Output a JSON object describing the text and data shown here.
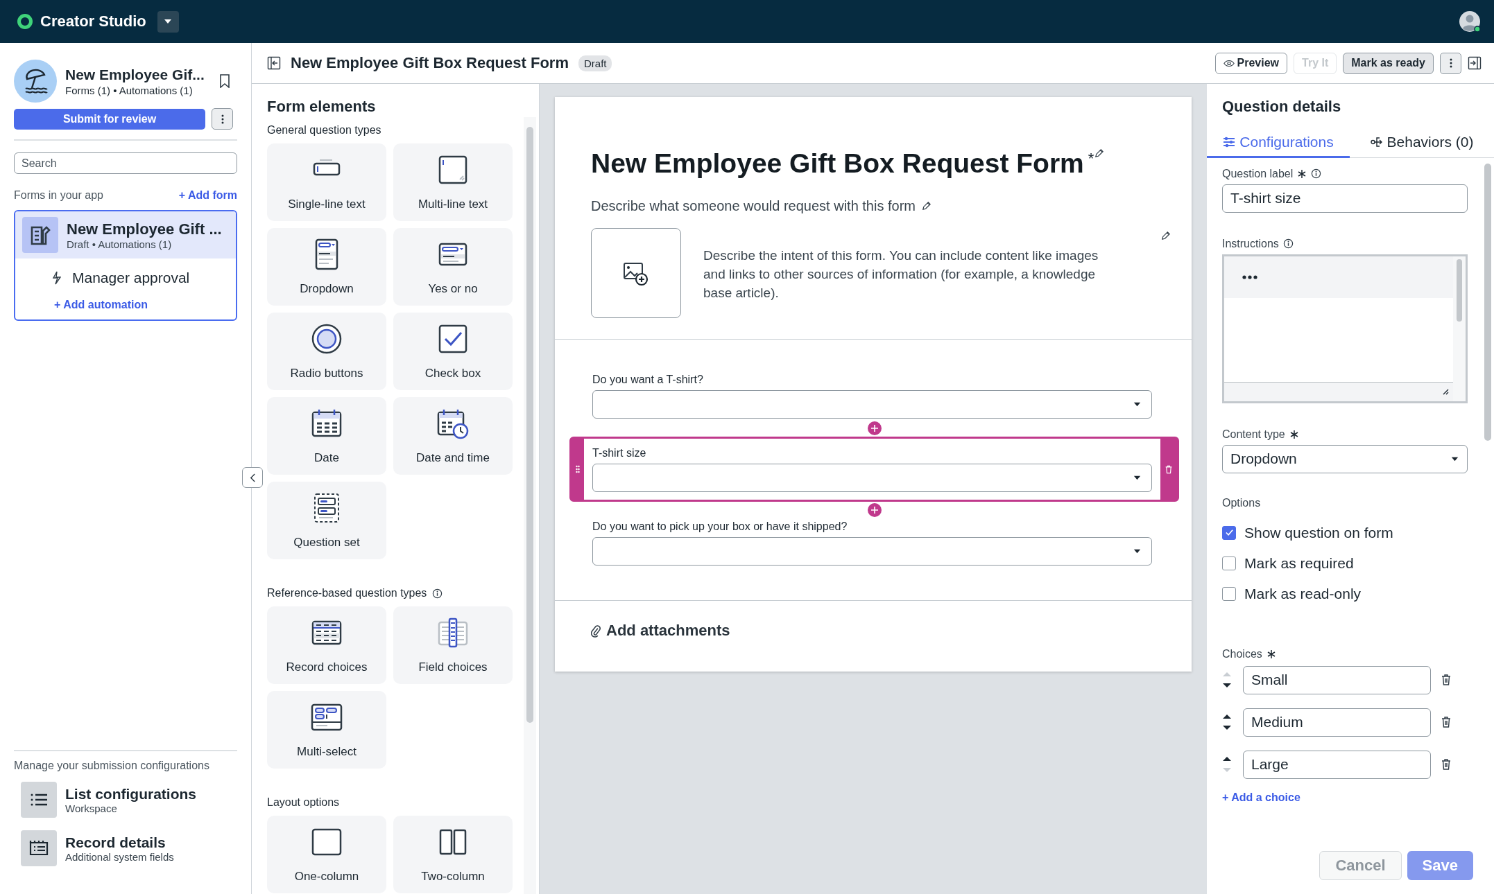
{
  "top_bar": {
    "app_name": "Creator Studio"
  },
  "app": {
    "name": "New Employee Gif...",
    "summary": "Forms (1) • Automations (1)",
    "submit_button": "Submit for review"
  },
  "search": {
    "placeholder": "Search"
  },
  "forms_panel": {
    "heading": "Forms in your app",
    "add_link": "+ Add form",
    "forms": [
      {
        "name": "New Employee Gift ...",
        "summary": "Draft • Automations (1)",
        "selected": true,
        "automations": [
          {
            "name": "Manager approval"
          }
        ],
        "add_link": "+ Add automation"
      }
    ]
  },
  "configurations": {
    "heading": "Manage your submission configurations",
    "items": [
      {
        "kind": "list",
        "title": "List configurations",
        "subtitle": "Workspace"
      },
      {
        "kind": "record",
        "title": "Record details",
        "subtitle": "Additional system fields"
      }
    ]
  },
  "header": {
    "title": "New Employee Gift Box Request Form",
    "status": "Draft",
    "buttons": [
      {
        "label": "Preview",
        "kind": "preview",
        "disabled": false
      },
      {
        "label": "Try It",
        "kind": "plain",
        "disabled": true
      },
      {
        "label": "Mark as ready",
        "kind": "filled",
        "disabled": false
      }
    ]
  },
  "form_elements": {
    "title": "Form elements",
    "sections": [
      {
        "label": "General question types",
        "info": false,
        "items": [
          {
            "label": "Single-line text",
            "kind": "single"
          },
          {
            "label": "Multi-line text",
            "kind": "multi"
          },
          {
            "label": "Dropdown",
            "kind": "dropdown"
          },
          {
            "label": "Yes or no",
            "kind": "yesno"
          },
          {
            "label": "Radio buttons",
            "kind": "radio"
          },
          {
            "label": "Check box",
            "kind": "checkbox"
          },
          {
            "label": "Date",
            "kind": "date"
          },
          {
            "label": "Date and time",
            "kind": "datetime"
          },
          {
            "label": "Question set",
            "kind": "set"
          }
        ]
      },
      {
        "label": "Reference-based question types",
        "info": true,
        "items": [
          {
            "label": "Record choices",
            "kind": "record"
          },
          {
            "label": "Field choices",
            "kind": "field"
          },
          {
            "label": "Multi-select",
            "kind": "multiselect"
          }
        ]
      },
      {
        "label": "Layout options",
        "info": false,
        "items": [
          {
            "label": "One-column",
            "kind": "onecol"
          },
          {
            "label": "Two-column",
            "kind": "twocol"
          }
        ]
      }
    ]
  },
  "form": {
    "title": "New Employee Gift Box Request Form",
    "title_mark": "*",
    "description": "Describe what someone would request with this form",
    "intent": "Describe the intent of this form. You can include content like images and links to other sources of information (for example, a knowledge base article).",
    "questions": [
      {
        "label": "Do you want a T-shirt?",
        "selected": false
      },
      {
        "label": "T-shirt size",
        "selected": true
      },
      {
        "label": "Do you want to pick up your box or have it shipped?",
        "selected": false
      }
    ],
    "attachments": "Add attachments"
  },
  "question_details": {
    "title": "Question details",
    "tabs": [
      {
        "label": "Configurations",
        "kind": "configurations",
        "selected": true
      },
      {
        "label": "Behaviors (0)",
        "kind": "behaviors",
        "selected": false
      }
    ],
    "question_label": {
      "label": "Question label",
      "required": true,
      "info": true,
      "value": "T-shirt size"
    },
    "instructions": {
      "label": "Instructions",
      "required": false,
      "info": true
    },
    "content_type": {
      "label": "Content type",
      "required": true,
      "info": false,
      "value": "Dropdown"
    },
    "options_heading": "Options",
    "options": [
      {
        "label": "Show question on form",
        "checked": true
      },
      {
        "label": "Mark as required",
        "checked": false
      },
      {
        "label": "Mark as read-only",
        "checked": false
      }
    ],
    "choices_heading": "Choices",
    "choices_required": true,
    "choices": [
      {
        "value": "Small",
        "up_disabled": true,
        "down_disabled": false
      },
      {
        "value": "Medium",
        "up_disabled": false,
        "down_disabled": false
      },
      {
        "value": "Large",
        "up_disabled": false,
        "down_disabled": true
      }
    ],
    "add_choice": "+ Add a choice",
    "buttons": [
      {
        "label": "Cancel",
        "kind": "secondary",
        "disabled": true
      },
      {
        "label": "Save",
        "kind": "primary",
        "disabled": true
      }
    ]
  }
}
